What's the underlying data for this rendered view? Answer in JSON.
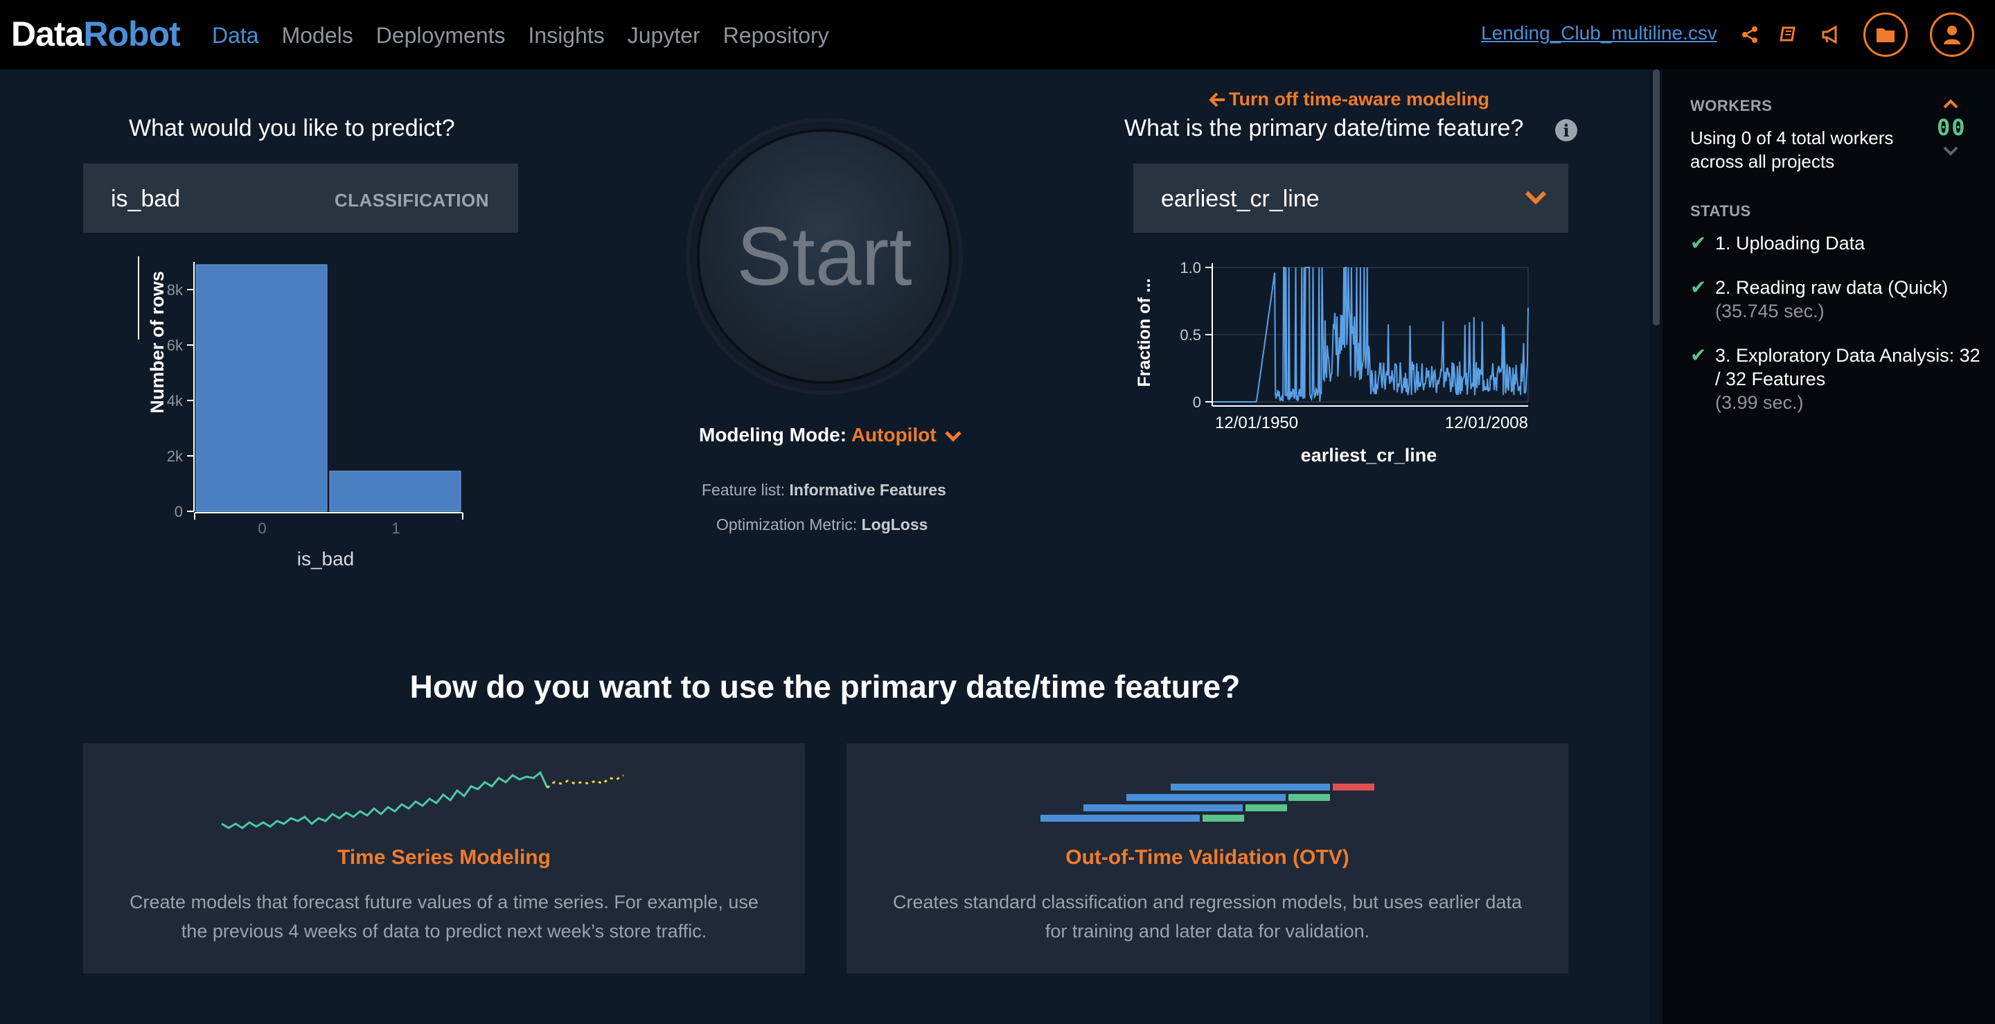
{
  "header": {
    "logo_part1": "Data",
    "logo_part2": "Robot",
    "nav": [
      "Data",
      "Models",
      "Deployments",
      "Insights",
      "Jupyter",
      "Repository"
    ],
    "active_nav": "Data",
    "filename": "Lending_Club_multiline.csv",
    "icons": [
      "share-icon",
      "book-icon",
      "megaphone-icon",
      "folder-icon",
      "user-icon"
    ],
    "accent_color": "#f07b2c",
    "brand_color": "#4a90d9"
  },
  "target": {
    "question": "What would you like to predict?",
    "name": "is_bad",
    "type": "CLASSIFICATION"
  },
  "date_feature": {
    "turn_off_link": "Turn off time-aware modeling",
    "question": "What is the primary date/time feature?",
    "selected": "earliest_cr_line"
  },
  "start": {
    "label": "Start",
    "mode_label": "Modeling Mode:",
    "mode_value": "Autopilot",
    "feature_list_label": "Feature list:",
    "feature_list_value": "Informative Features",
    "metric_label": "Optimization Metric:",
    "metric_value": "LogLoss"
  },
  "chart_data": [
    {
      "type": "bar",
      "categories": [
        "0",
        "1"
      ],
      "values": [
        8900,
        1450
      ],
      "xlabel": "is_bad",
      "ylabel": "Number of rows",
      "ylim": [
        0,
        9000
      ],
      "yticks": [
        "0",
        "2k",
        "4k",
        "6k",
        "8k"
      ],
      "color": "#4a7fc1"
    },
    {
      "type": "line",
      "xlabel": "earliest_cr_line",
      "ylabel": "Fraction of ...",
      "xticks": [
        "12/01/1950",
        "12/01/2008"
      ],
      "yticks": [
        "0",
        "0.5",
        "1.0"
      ],
      "ylim": [
        0,
        1
      ],
      "grid": true,
      "color": "#5aa0e6"
    }
  ],
  "usage": {
    "title": "How do you want to use the primary date/time feature?",
    "cards": [
      {
        "title": "Time Series Modeling",
        "desc": "Create models that forecast future values of a time series. For example, use the previous 4 weeks of data to predict next week’s store traffic."
      },
      {
        "title": "Out-of-Time Validation (OTV)",
        "desc": "Creates standard classification and regression models, but uses earlier data for training and later data for validation."
      }
    ]
  },
  "right_panel": {
    "workers_title": "WORKERS",
    "workers_text": "Using 0 of 4 total workers across all projects",
    "workers_count": "00",
    "status_title": "STATUS",
    "status_items": [
      {
        "label": "1. Uploading Data",
        "sub": ""
      },
      {
        "label": "2. Reading raw data (Quick)",
        "sub": "(35.745 sec.)"
      },
      {
        "label": "3. Exploratory Data Analysis: 32 / 32 Features",
        "sub": "(3.99 sec.)"
      }
    ]
  }
}
